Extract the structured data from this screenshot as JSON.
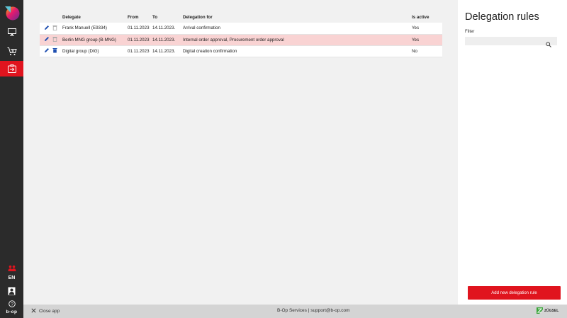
{
  "sidebar": {
    "items": [
      {
        "name": "monitor-icon"
      },
      {
        "name": "cart-add-icon"
      },
      {
        "name": "delegation-icon",
        "active": true
      }
    ],
    "lang": "EN",
    "brand": "b-op"
  },
  "table": {
    "headers": [
      "Delegate",
      "From",
      "To",
      "Delegation for",
      "Is active"
    ],
    "rows": [
      {
        "delegate": "Frank Manuell (E9334)",
        "from": "01.11.2023",
        "to": "14.11.2023.",
        "for": "Arrival confirmation",
        "active": "Yes"
      },
      {
        "delegate": "Berlin MNG group (B-MNG)",
        "from": "01.11.2023",
        "to": "14.11.2023.",
        "for": "Internal order approval, Procurement order approval",
        "active": "Yes"
      },
      {
        "delegate": "Digital group (DIG)",
        "from": "01.11.2023",
        "to": "14.11.2023.",
        "for": "Digital creation confirmation",
        "active": "No"
      }
    ]
  },
  "panel": {
    "title": "Delegation rules",
    "filter_label": "Filter",
    "filter_value": "",
    "add_button": "Add new delegation rule"
  },
  "footer": {
    "close_label": "Close app",
    "center_text": "B-Op Services | support@b-op.com",
    "brand": "ZÜGSEL"
  },
  "colors": {
    "accent": "#e0141e",
    "sidebar": "#2b2b2b",
    "row_highlight": "#f9d3d3",
    "edit_icon": "#1f4fb0"
  }
}
